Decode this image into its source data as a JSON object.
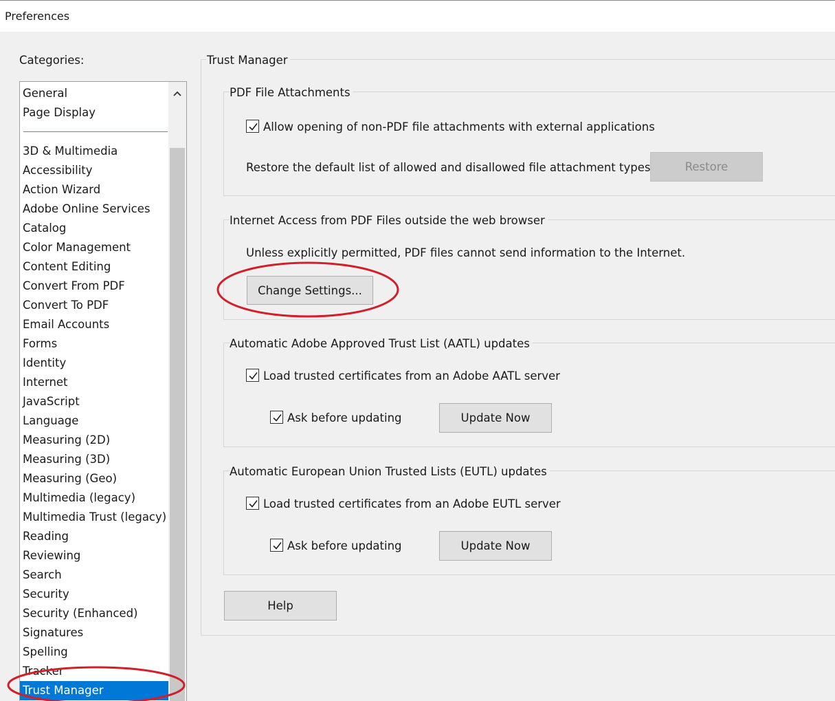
{
  "window": {
    "title": "Preferences"
  },
  "categories": {
    "label": "Categories:",
    "top_items": [
      "General",
      "Page Display"
    ],
    "items": [
      "3D & Multimedia",
      "Accessibility",
      "Action Wizard",
      "Adobe Online Services",
      "Catalog",
      "Color Management",
      "Content Editing",
      "Convert From PDF",
      "Convert To PDF",
      "Email Accounts",
      "Forms",
      "Identity",
      "Internet",
      "JavaScript",
      "Language",
      "Measuring (2D)",
      "Measuring (3D)",
      "Measuring (Geo)",
      "Multimedia (legacy)",
      "Multimedia Trust (legacy)",
      "Reading",
      "Reviewing",
      "Search",
      "Security",
      "Security (Enhanced)",
      "Signatures",
      "Spelling",
      "Tracker",
      "Trust Manager"
    ],
    "selected": "Trust Manager"
  },
  "panel": {
    "title": "Trust Manager",
    "attachments": {
      "title": "PDF File Attachments",
      "allow_label": "Allow opening of non-PDF file attachments with external applications",
      "allow_checked": true,
      "restore_text": "Restore the default list of allowed and disallowed file attachment types:",
      "restore_button": "Restore"
    },
    "internet": {
      "title": "Internet Access from PDF Files outside the web browser",
      "info": "Unless explicitly permitted, PDF files cannot send information to the Internet.",
      "change_button": "Change Settings..."
    },
    "aatl": {
      "title": "Automatic Adobe Approved Trust List (AATL) updates",
      "load_label": "Load trusted certificates from an Adobe AATL server",
      "load_checked": true,
      "ask_label": "Ask before updating",
      "ask_checked": true,
      "update_button": "Update Now"
    },
    "eutl": {
      "title": "Automatic European Union Trusted Lists (EUTL) updates",
      "load_label": "Load trusted certificates from an Adobe EUTL server",
      "load_checked": true,
      "ask_label": "Ask before updating",
      "ask_checked": true,
      "update_button": "Update Now"
    },
    "help_button": "Help"
  },
  "colors": {
    "selection": "#0078d7",
    "annotation": "#d0202a"
  }
}
